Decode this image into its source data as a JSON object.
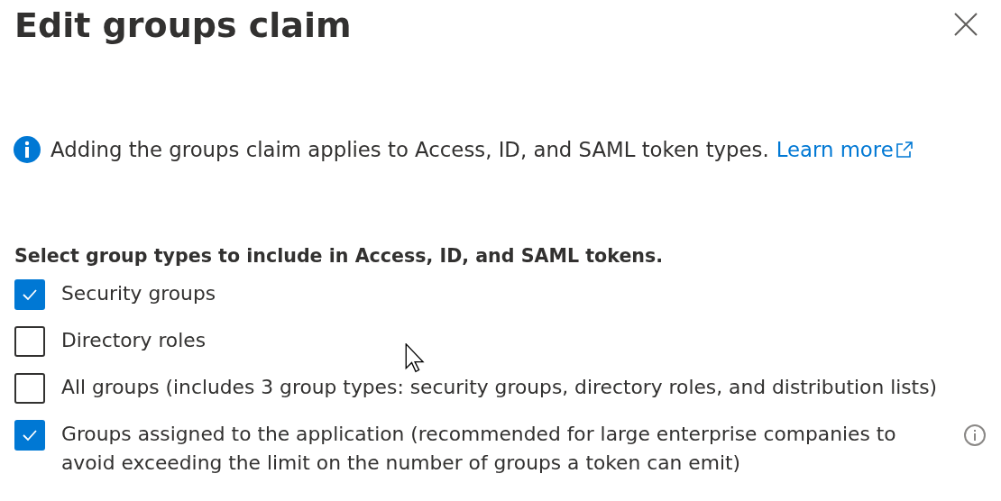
{
  "panel": {
    "title": "Edit groups claim"
  },
  "notice": {
    "text": "Adding the groups claim applies to Access, ID, and SAML token types.",
    "link": "Learn more"
  },
  "group_types": {
    "heading": "Select group types to include in Access, ID, and SAML tokens.",
    "options": [
      {
        "label": "Security groups",
        "checked": true,
        "info": false
      },
      {
        "label": "Directory roles",
        "checked": false,
        "info": false
      },
      {
        "label": "All groups (includes 3 group types: security groups, directory roles, and distribution lists)",
        "checked": false,
        "info": false
      },
      {
        "label": "Groups assigned to the application (recommended for large enterprise companies to avoid exceeding the limit on the number of groups a token can emit)",
        "checked": true,
        "info": true
      }
    ]
  }
}
